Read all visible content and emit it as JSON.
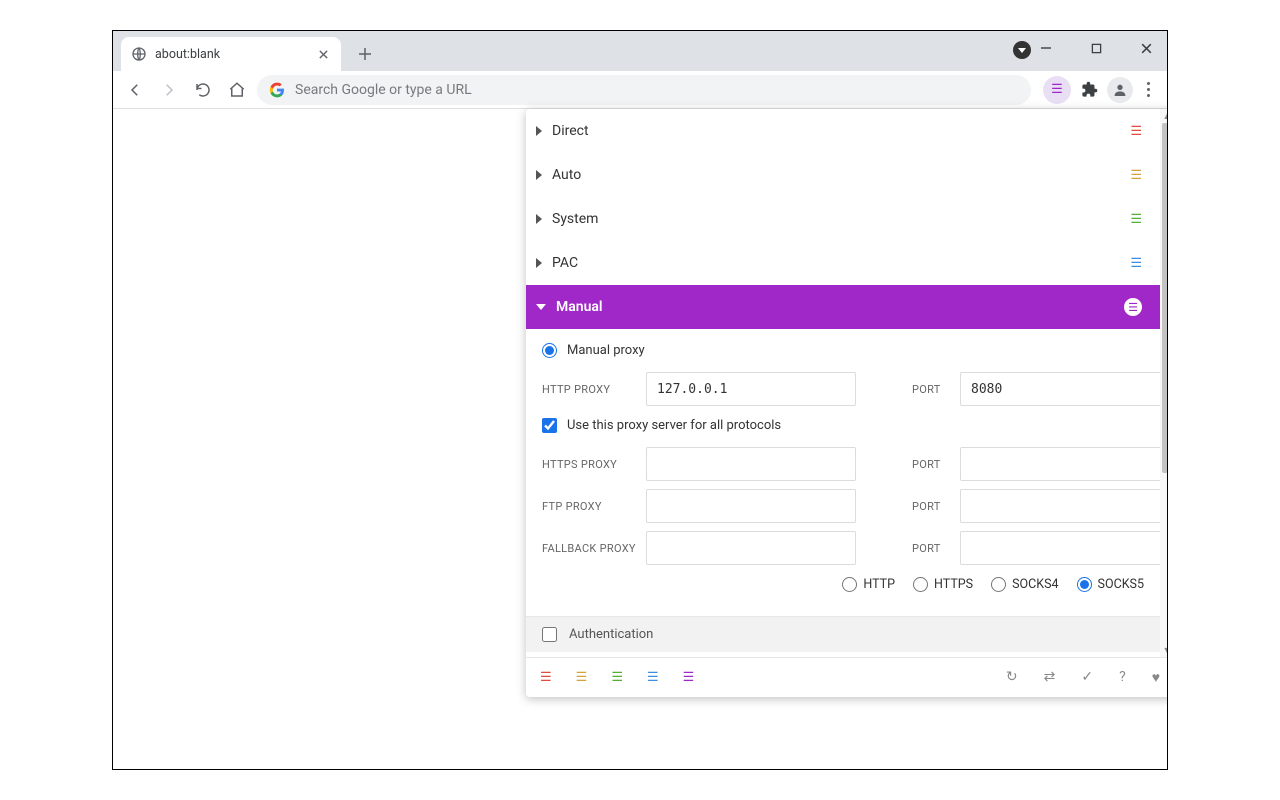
{
  "tab": {
    "title": "about:blank"
  },
  "omnibox": {
    "placeholder": "Search Google or type a URL"
  },
  "sections": [
    {
      "label": "Direct",
      "color": "#e04a3f"
    },
    {
      "label": "Auto",
      "color": "#d6a23a"
    },
    {
      "label": "System",
      "color": "#54b035"
    },
    {
      "label": "PAC",
      "color": "#3b8de0"
    }
  ],
  "activeSection": {
    "label": "Manual",
    "color": "#a028c8"
  },
  "manual": {
    "radioLabel": "Manual proxy",
    "httpLabel": "HTTP PROXY",
    "httpValue": "127.0.0.1",
    "portLabel": "PORT",
    "httpPort": "8080",
    "useAllLabel": "Use this proxy server for all protocols",
    "httpsLabel": "HTTPS PROXY",
    "httpsValue": "",
    "httpsPort": "",
    "ftpLabel": "FTP PROXY",
    "ftpValue": "",
    "ftpPort": "",
    "fallbackLabel": "FALLBACK PROXY",
    "fallbackValue": "",
    "fallbackPort": "",
    "protoOptions": [
      "HTTP",
      "HTTPS",
      "SOCKS4",
      "SOCKS5"
    ],
    "protoSelected": "SOCKS5",
    "authLabel": "Authentication"
  },
  "footerColors": [
    "#e04a3f",
    "#d6a23a",
    "#54b035",
    "#3b8de0",
    "#a028c8"
  ]
}
